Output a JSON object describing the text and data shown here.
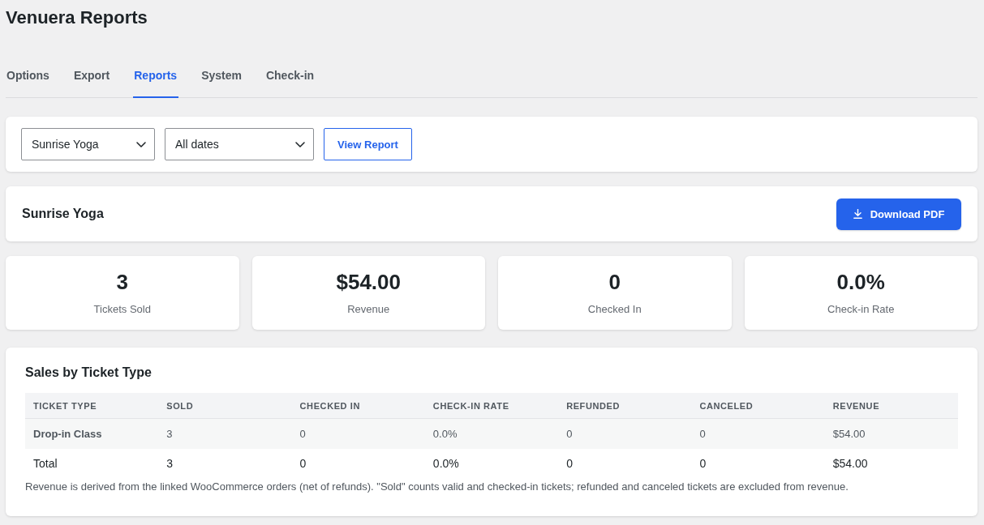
{
  "page": {
    "title": "Venuera Reports"
  },
  "tabs": [
    {
      "label": "Options",
      "selected": false
    },
    {
      "label": "Export",
      "selected": false
    },
    {
      "label": "Reports",
      "selected": true
    },
    {
      "label": "System",
      "selected": false
    },
    {
      "label": "Check-in",
      "selected": false
    }
  ],
  "filters": {
    "selects": [
      {
        "value": "Sunrise Yoga"
      },
      {
        "value": "All dates"
      }
    ],
    "view_button": "View Report"
  },
  "report_header": {
    "title": "Sunrise Yoga",
    "download_button": "Download PDF"
  },
  "stats": [
    {
      "value": "3",
      "label": "Tickets Sold"
    },
    {
      "value": "$54.00",
      "label": "Revenue"
    },
    {
      "value": "0",
      "label": "Checked In"
    },
    {
      "value": "0.0%",
      "label": "Check-in Rate"
    }
  ],
  "sales_table": {
    "title": "Sales by Ticket Type",
    "columns": [
      "TICKET TYPE",
      "SOLD",
      "CHECKED IN",
      "CHECK-IN RATE",
      "REFUNDED",
      "CANCELED",
      "REVENUE"
    ],
    "rows": [
      {
        "kind": "item",
        "cells": [
          "Drop-in Class",
          "3",
          "0",
          "0.0%",
          "0",
          "0",
          "$54.00"
        ]
      },
      {
        "kind": "total",
        "cells": [
          "Total",
          "3",
          "0",
          "0.0%",
          "0",
          "0",
          "$54.00"
        ]
      }
    ],
    "note": "Revenue is derived from the linked WooCommerce orders (net of refunds). \"Sold\" counts valid and checked-in tickets; refunded and canceled tickets are excluded from revenue."
  }
}
